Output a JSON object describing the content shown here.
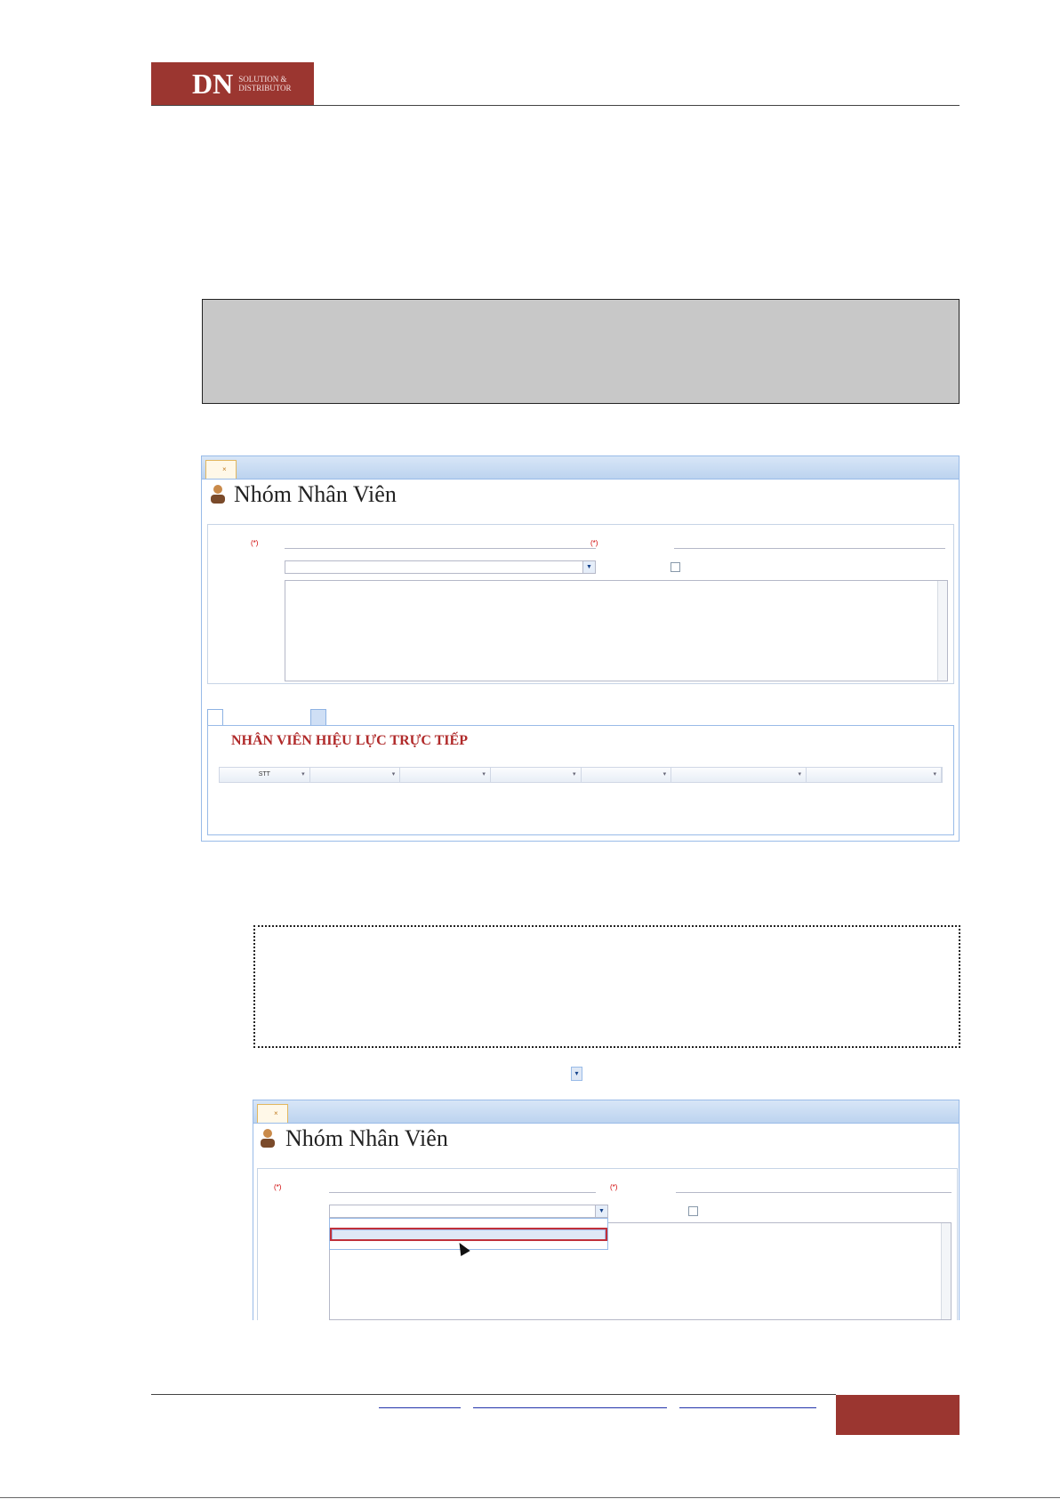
{
  "header": {
    "logo_main": "DN",
    "logo_sub_line1": "SOLUTION &",
    "logo_sub_line2": "DISTRIBUTOR"
  },
  "screenshot1": {
    "tab_label": "",
    "tab_close": "×",
    "title": "Nhóm Nhân Viên",
    "actions": [
      "",
      "",
      ""
    ],
    "fields": {
      "name_label": "",
      "name_required": "(*)",
      "name_value": "",
      "code_label": "",
      "code_required": "(*)",
      "code_value": "",
      "effect_label": "",
      "effect_value": "",
      "checkbox_label": "",
      "notes_label": ""
    },
    "tabs": [
      "",
      ""
    ],
    "grid_title": "NHÂN VIÊN HIỆU LỰC TRỰC TIẾP",
    "grid_actions": [
      "",
      "",
      ""
    ],
    "grid_columns": [
      "STT",
      "",
      "",
      "",
      "",
      "",
      ""
    ],
    "grid_empty": ""
  },
  "screenshot2": {
    "tab_label": "",
    "tab_close": "×",
    "title": "Nhóm Nhân Viên",
    "actions": [
      "",
      ""
    ],
    "fields": {
      "name_label": "",
      "name_required": "(*)",
      "name_value": "",
      "code_label": "",
      "code_required": "(*)",
      "code_value": "",
      "effect_label": "",
      "effect_value": "",
      "checkbox_label": "",
      "notes_label": ""
    },
    "dropdown_options": [
      "",
      "",
      ""
    ],
    "highlighted_index": 1
  },
  "small_combo_icon": "▾",
  "colors": {
    "brand": "#9b3630",
    "ext_border": "#99bbe8",
    "grid_title": "#b02a2a"
  }
}
